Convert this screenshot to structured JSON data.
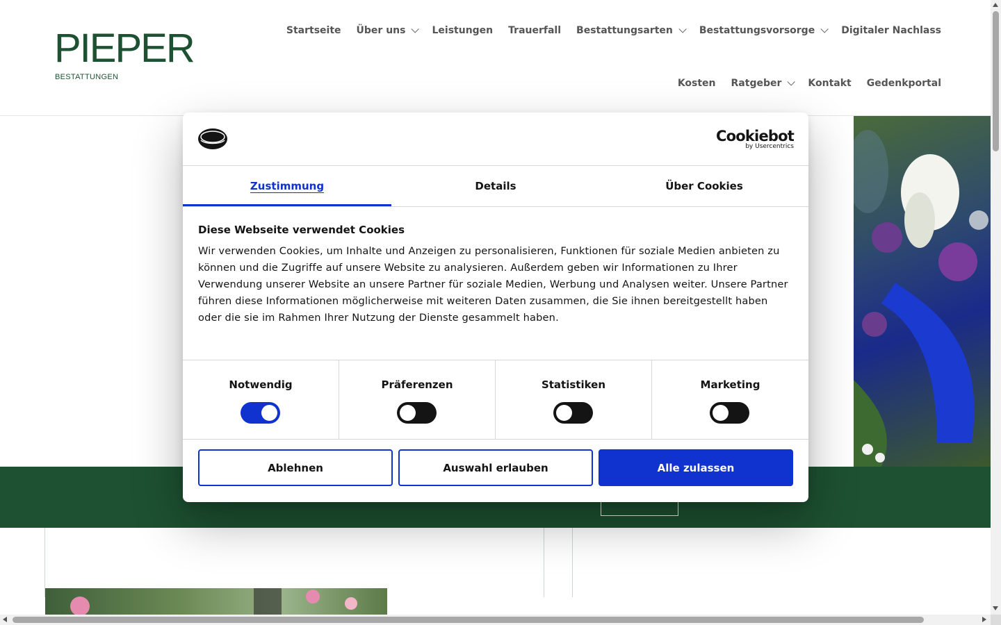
{
  "header": {
    "logo_word": "PIEPER",
    "logo_sub": "BESTATTUNGEN",
    "nav": [
      {
        "label": "Startseite",
        "active": true,
        "has_dropdown": false
      },
      {
        "label": "Über uns",
        "active": false,
        "has_dropdown": true
      },
      {
        "label": "Leistungen",
        "active": false,
        "has_dropdown": false
      },
      {
        "label": "Trauerfall",
        "active": false,
        "has_dropdown": false
      },
      {
        "label": "Bestattungsarten",
        "active": false,
        "has_dropdown": true
      },
      {
        "label": "Bestattungsvorsorge",
        "active": false,
        "has_dropdown": true
      },
      {
        "label": "Digitaler Nachlass",
        "active": false,
        "has_dropdown": false
      },
      {
        "label": "Kosten",
        "active": false,
        "has_dropdown": false
      },
      {
        "label": "Ratgeber",
        "active": false,
        "has_dropdown": true
      },
      {
        "label": "Kontakt",
        "active": false,
        "has_dropdown": false
      },
      {
        "label": "Gedenkportal",
        "active": false,
        "has_dropdown": false
      }
    ]
  },
  "colors": {
    "brand_green": "#1d5131",
    "cookiebot_blue": "#1032cf",
    "text_dark": "#141414"
  },
  "cookie_dialog": {
    "brand": "Cookiebot",
    "brand_sub": "by Usercentrics",
    "tabs": [
      {
        "label": "Zustimmung",
        "active": true
      },
      {
        "label": "Details",
        "active": false
      },
      {
        "label": "Über Cookies",
        "active": false
      }
    ],
    "title": "Diese Webseite verwendet Cookies",
    "text": "Wir verwenden Cookies, um Inhalte und Anzeigen zu personalisieren, Funktionen für soziale Medien anbieten zu können und die Zugriffe auf unsere Website zu analysieren. Außerdem geben wir Informationen zu Ihrer Verwendung unserer Website an unsere Partner für soziale Medien, Werbung und Analysen weiter. Unsere Partner führen diese Informationen möglicherweise mit weiteren Daten zusammen, die Sie ihnen bereitgestellt haben oder die sie im Rahmen Ihrer Nutzung der Dienste gesammelt haben.",
    "categories": [
      {
        "label": "Notwendig",
        "enabled": true
      },
      {
        "label": "Präferenzen",
        "enabled": false
      },
      {
        "label": "Statistiken",
        "enabled": false
      },
      {
        "label": "Marketing",
        "enabled": false
      }
    ],
    "buttons": {
      "decline": "Ablehnen",
      "allow_selection": "Auswahl erlauben",
      "allow_all": "Alle zulassen"
    }
  }
}
